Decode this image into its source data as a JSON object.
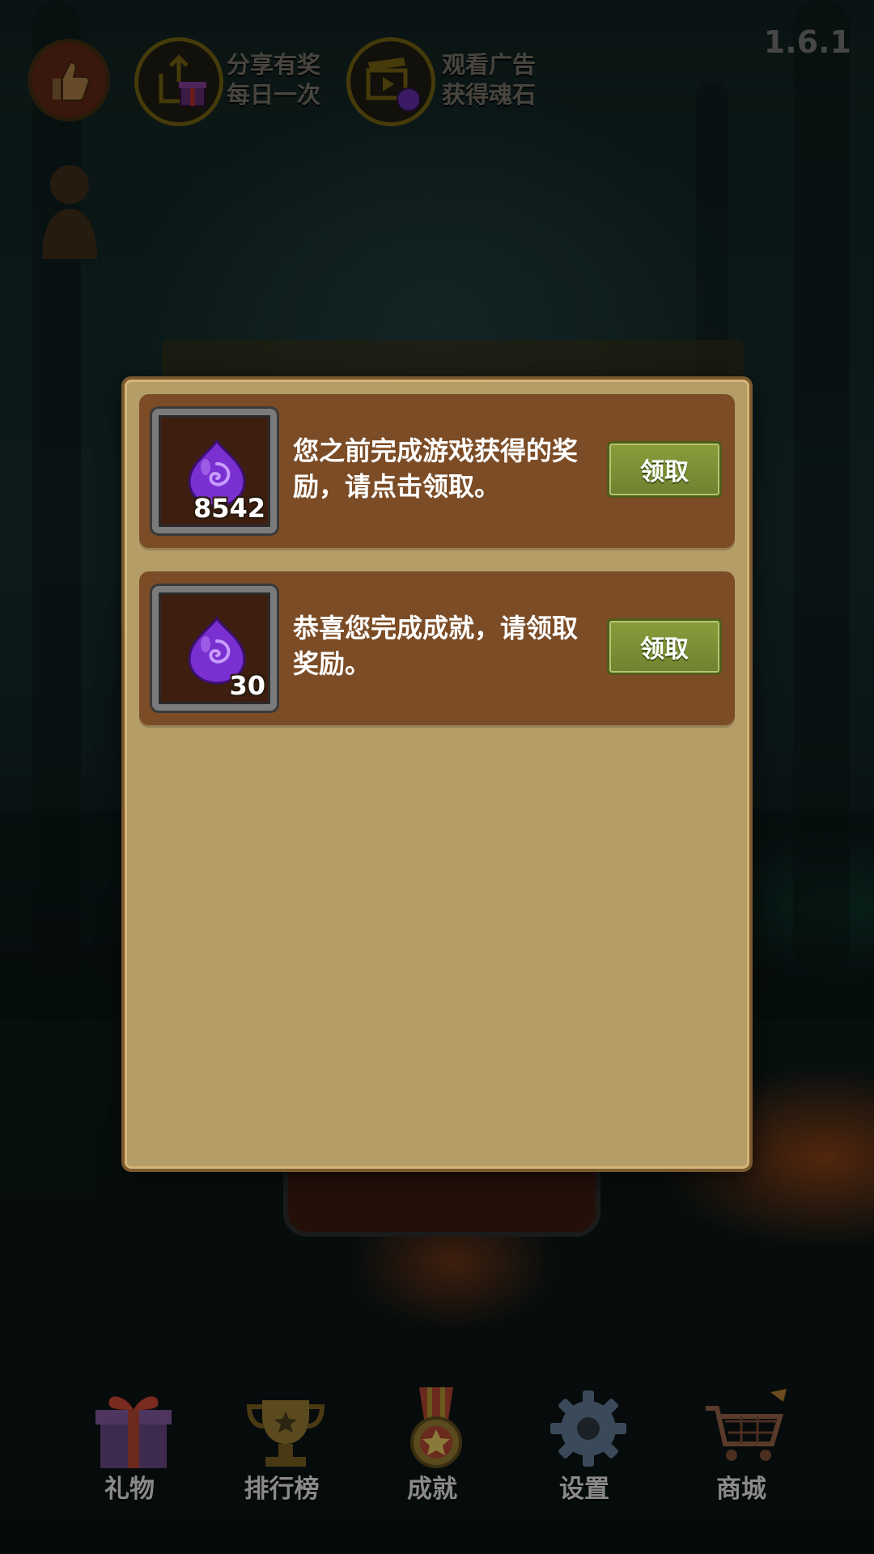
{
  "version": "1.6.1",
  "top_bar": {
    "share": {
      "line1": "分享有奖",
      "line2": "每日一次",
      "icon": "share-gift-icon"
    },
    "ad": {
      "line1": "观看广告",
      "line2": "获得魂石",
      "icon": "video-ad-icon"
    },
    "like_icon": "thumbs-up-icon"
  },
  "rewards": [
    {
      "count": "8542",
      "message": "您之前完成游戏获得的奖励，请点击领取。",
      "button": "领取",
      "icon": "soul-stone-icon"
    },
    {
      "count": "30",
      "message": "恭喜您完成成就，请领取奖励。",
      "button": "领取",
      "icon": "soul-stone-icon"
    }
  ],
  "bottom_nav": [
    {
      "label": "礼物",
      "icon": "gift-box-icon"
    },
    {
      "label": "排行榜",
      "icon": "trophy-icon"
    },
    {
      "label": "成就",
      "icon": "medal-icon"
    },
    {
      "label": "设置",
      "icon": "gear-icon"
    },
    {
      "label": "商城",
      "icon": "shopping-cart-icon"
    }
  ],
  "colors": {
    "modal_bg": "#b49d67",
    "row_bg": "#7b4c26",
    "claim_button": "#7a8e34",
    "gem": "#7a2fd0"
  }
}
